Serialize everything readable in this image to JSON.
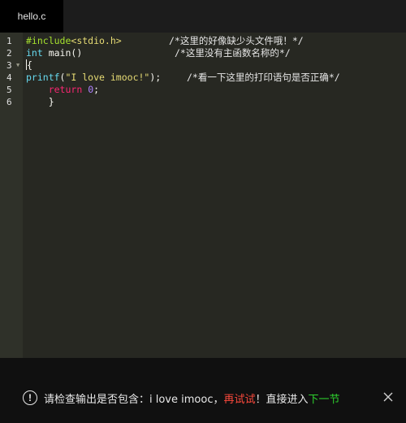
{
  "tab": {
    "filename": "hello.c"
  },
  "gutter": {
    "lines": [
      "1",
      "2",
      "3",
      "4",
      "5",
      "6"
    ],
    "fold_marker": "▼"
  },
  "code": {
    "line1": {
      "directive": "#include",
      "header": "<stdio.h>"
    },
    "line2": {
      "type": "int",
      "name": " main()"
    },
    "line3": {
      "brace": "{"
    },
    "line4": {
      "fn": "printf",
      "open": "(",
      "str": "\"I love imooc!\"",
      "close": ");"
    },
    "line5": {
      "indent": "    ",
      "kw": "return",
      "space": " ",
      "num": "0",
      "semi": ";"
    },
    "line6": {
      "indent": "    ",
      "brace": "}"
    },
    "comments": {
      "c1": "/*这里的好像缺少头文件哦！*/",
      "c2": "/*这里没有主函数名称的*/",
      "c4": "/*看一下这里的打印语句是否正确*/"
    }
  },
  "bottom": {
    "info_icon": "!",
    "prefix": "请检查输出是否包含：i love imooc，",
    "retry": "再试试",
    "middle": "！直接进入",
    "next": "下一节"
  },
  "colors": {
    "editor_bg": "#272822",
    "gutter_bg": "#2f3129",
    "retry": "#ff4a3d",
    "next": "#2ed12e"
  }
}
